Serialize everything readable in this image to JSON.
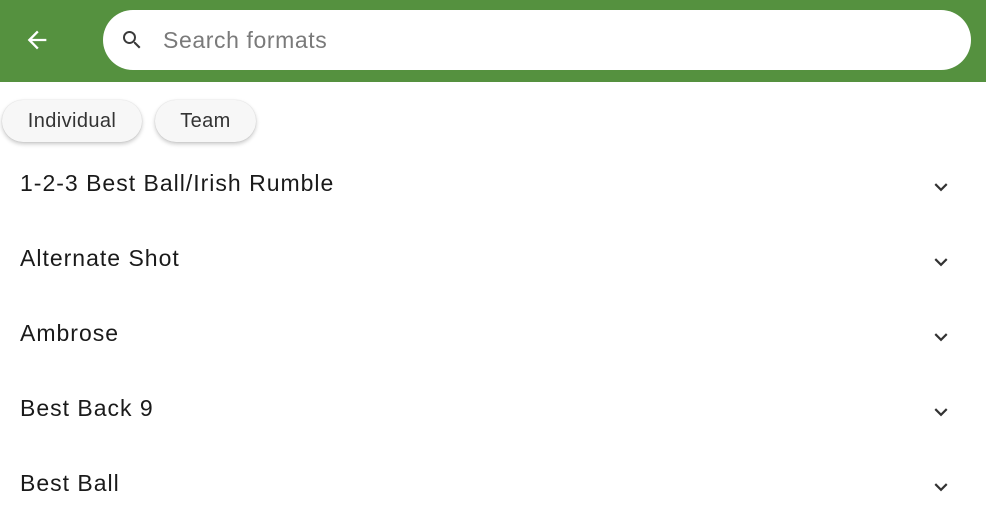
{
  "app_bar": {
    "background_color": "#55913f",
    "back_icon": "arrow-left-icon"
  },
  "search": {
    "icon": "search-icon",
    "placeholder": "Search formats",
    "value": ""
  },
  "filters": [
    {
      "label": "Individual"
    },
    {
      "label": "Team"
    }
  ],
  "formats": [
    {
      "label": "1-2-3 Best Ball/Irish Rumble",
      "icon": "chevron-down-icon"
    },
    {
      "label": "Alternate Shot",
      "icon": "chevron-down-icon"
    },
    {
      "label": "Ambrose",
      "icon": "chevron-down-icon"
    },
    {
      "label": "Best Back 9",
      "icon": "chevron-down-icon"
    },
    {
      "label": "Best Ball",
      "icon": "chevron-down-icon"
    }
  ]
}
